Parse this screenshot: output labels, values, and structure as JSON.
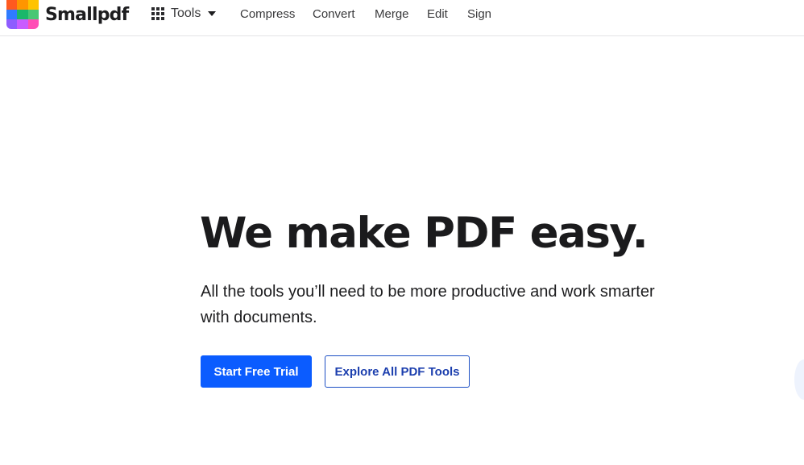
{
  "header": {
    "brand": "Smallpdf",
    "tools_label": "Tools",
    "nav": [
      "Compress",
      "Convert",
      "Merge",
      "Edit",
      "Sign"
    ]
  },
  "hero": {
    "title": "We make PDF easy.",
    "subtitle": "All the tools you’ll need to be more productive and work smarter with documents.",
    "primary_cta": "Start Free Trial",
    "secondary_cta": "Explore All PDF Tools"
  },
  "colors": {
    "primary": "#0b5cff",
    "secondary_border": "#1c4fc4",
    "logo_tiles": [
      "#ff5a1f",
      "#ff9500",
      "#ffc300",
      "#2f7bff",
      "#1ab76b",
      "#48c774",
      "#8e5cff",
      "#c95cff",
      "#ff4fb6"
    ]
  },
  "icons": {
    "tools": "grid-icon",
    "tools_dropdown": "caret-down-icon",
    "logo": "smallpdf-logo-icon"
  }
}
